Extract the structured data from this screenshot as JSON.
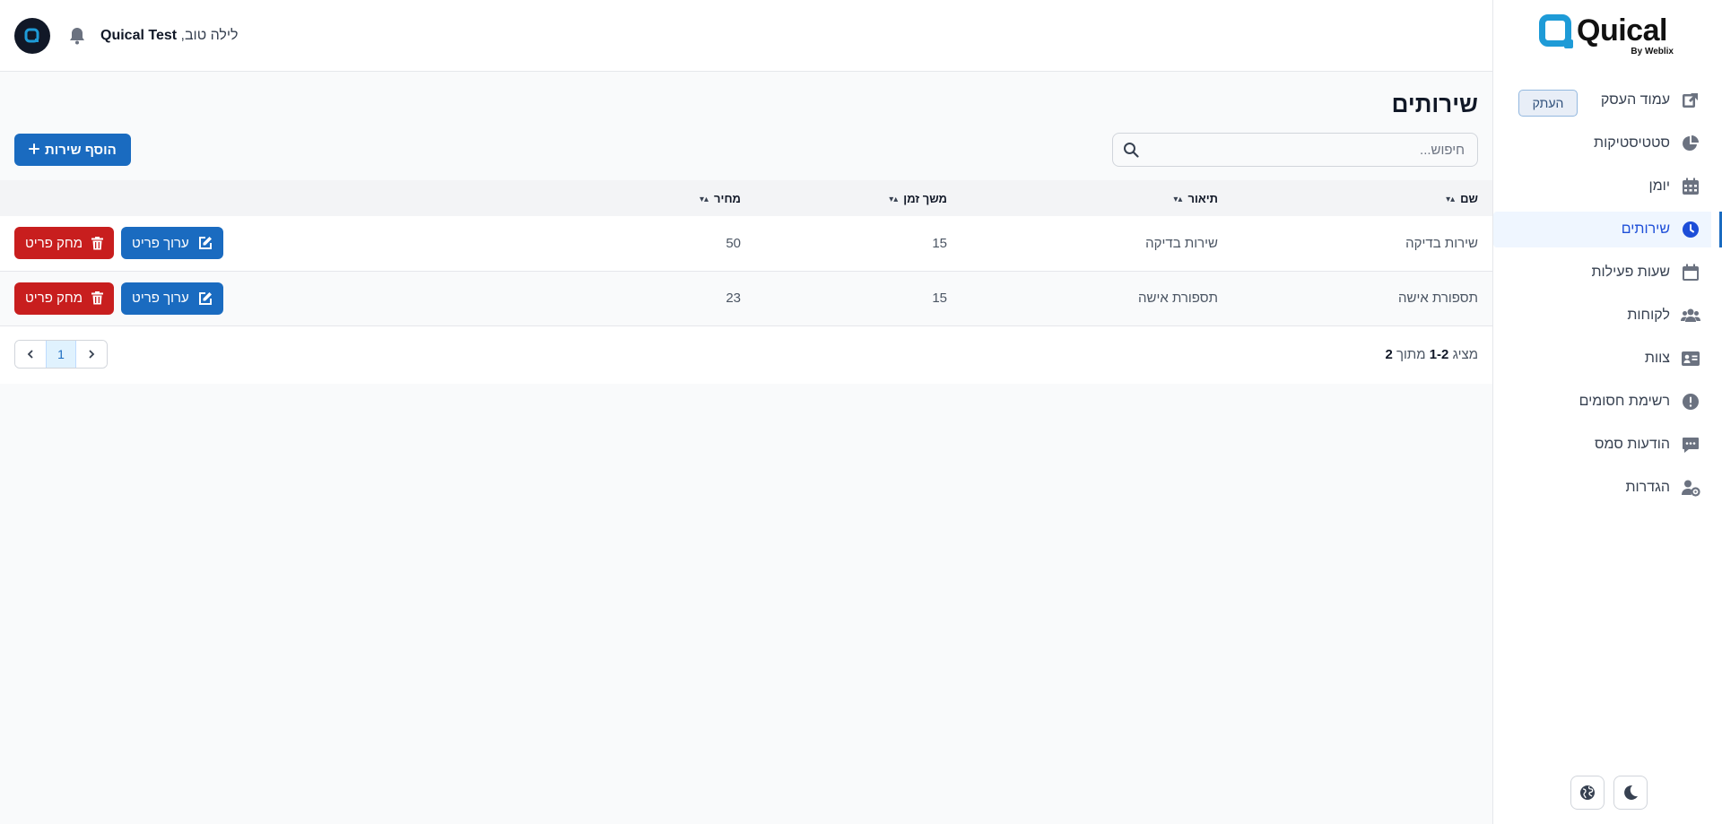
{
  "brand": {
    "name": "Quical",
    "byline": "By Weblix",
    "color": "#1e9bd7"
  },
  "sidebar": {
    "copy_label": "העתק",
    "items": [
      {
        "label": "עמוד העסק",
        "icon": "external-link-icon"
      },
      {
        "label": "סטטיסטיקות",
        "icon": "pie-chart-icon"
      },
      {
        "label": "יומן",
        "icon": "calendar-icon"
      },
      {
        "label": "שירותים",
        "icon": "clock-icon",
        "active": true
      },
      {
        "label": "שעות פעילות",
        "icon": "calendar-alt-icon"
      },
      {
        "label": "לקוחות",
        "icon": "users-icon"
      },
      {
        "label": "צוות",
        "icon": "id-card-icon"
      },
      {
        "label": "רשימת חסומים",
        "icon": "alert-icon"
      },
      {
        "label": "הודעות סמס",
        "icon": "message-icon"
      },
      {
        "label": "הגדרות",
        "icon": "user-settings-icon"
      }
    ]
  },
  "header": {
    "greeting_prefix": "לילה טוב,",
    "user_name": "Quical Test"
  },
  "main": {
    "title": "שירותים",
    "search_placeholder": "חיפוש...",
    "add_button": "הוסף שירות",
    "columns": [
      "שם",
      "תיאור",
      "משך זמן",
      "מחיר"
    ],
    "rows": [
      {
        "name": "שירות בדיקה",
        "description": "שירות בדיקה",
        "duration": "15",
        "price": "50"
      },
      {
        "name": "תספורת אישה",
        "description": "תספורת אישה",
        "duration": "15",
        "price": "23"
      }
    ],
    "edit_label": "ערוך פריט",
    "delete_label": "מחק פריט",
    "count": {
      "prefix": "מציג",
      "range": "1-2",
      "of": "מתוך",
      "total": "2"
    },
    "current_page": "1"
  },
  "colors": {
    "primary": "#1a6bc0",
    "danger": "#c81e1e"
  }
}
